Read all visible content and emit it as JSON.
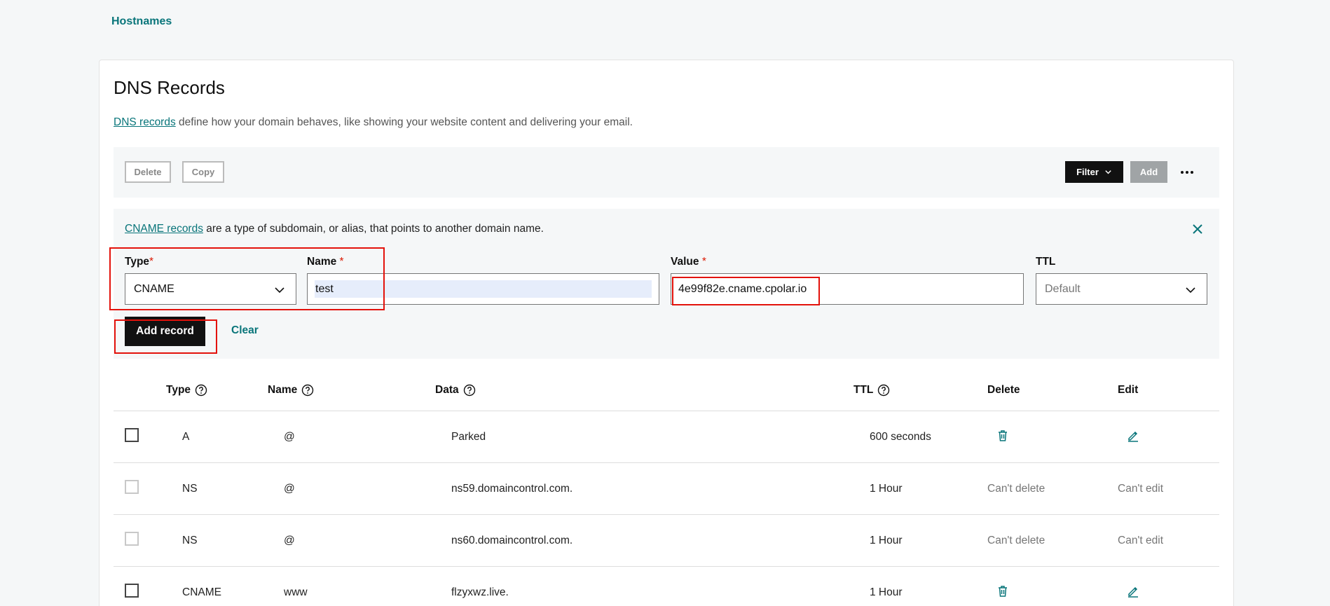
{
  "breadcrumb": {
    "hostnames": "Hostnames"
  },
  "page": {
    "title": "DNS Records",
    "intro_link": "DNS records",
    "intro_text": " define how your domain behaves, like showing your website content and delivering your email."
  },
  "toolbar": {
    "delete_label": "Delete",
    "copy_label": "Copy",
    "filter_label": "Filter",
    "add_label": "Add"
  },
  "form": {
    "info_link": "CNAME records",
    "info_text": " are a type of subdomain, or alias, that points to another domain name.",
    "type_label": "Type",
    "type_value": "CNAME",
    "name_label": "Name",
    "name_value": "test",
    "value_label": "Value",
    "value_value": "4e99f82e.cname.cpolar.io",
    "ttl_label": "TTL",
    "ttl_value": "Default",
    "required_mark": "*",
    "add_record_label": "Add record",
    "clear_label": "Clear"
  },
  "table": {
    "headers": {
      "type": "Type",
      "name": "Name",
      "data": "Data",
      "ttl": "TTL",
      "delete": "Delete",
      "edit": "Edit"
    },
    "rows": [
      {
        "type": "A",
        "name": "@",
        "data": "Parked",
        "ttl": "600 seconds",
        "delete": "",
        "edit": ""
      },
      {
        "type": "NS",
        "name": "@",
        "data": "ns59.domaincontrol.com.",
        "ttl": "1 Hour",
        "delete": "Can't delete",
        "edit": "Can't edit"
      },
      {
        "type": "NS",
        "name": "@",
        "data": "ns60.domaincontrol.com.",
        "ttl": "1 Hour",
        "delete": "Can't delete",
        "edit": "Can't edit"
      },
      {
        "type": "CNAME",
        "name": "www",
        "data": "flzyxwz.live.",
        "ttl": "1 Hour",
        "delete": "",
        "edit": ""
      }
    ]
  },
  "colors": {
    "accent": "#09757a",
    "annotation": "#e3120b",
    "button_dark": "#111111",
    "button_disabled": "#a0a4a6"
  }
}
